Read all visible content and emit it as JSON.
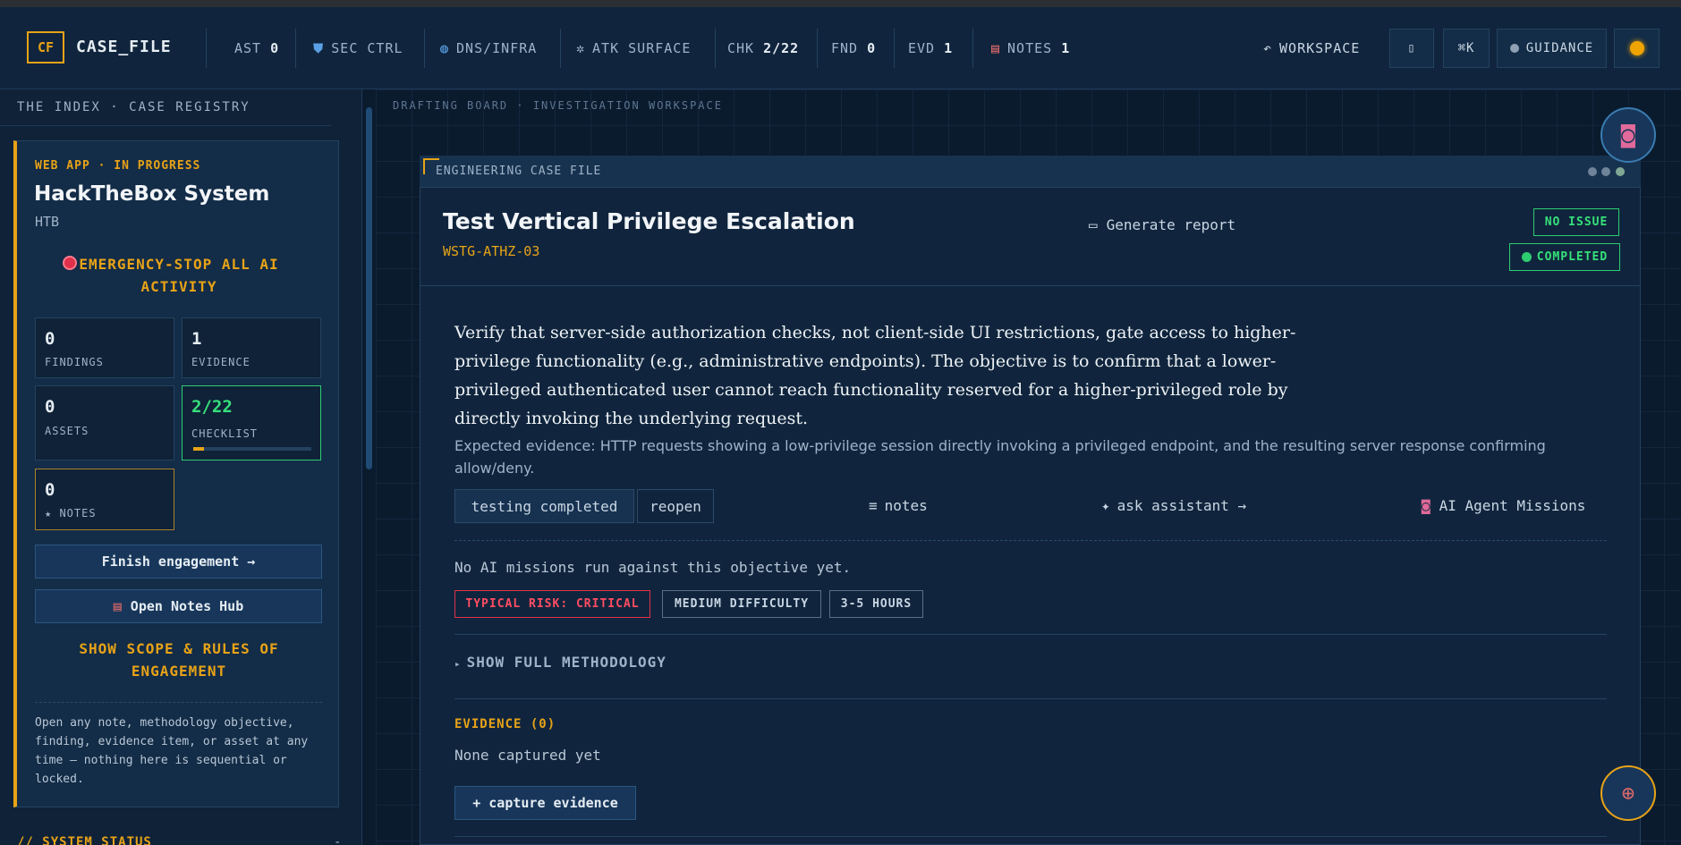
{
  "topbar": {
    "logo_mark": "CF",
    "logo_text": "CASE_FILE",
    "stats": [
      {
        "label": "AST",
        "value": "0"
      },
      {
        "label": "SEC CTRL",
        "icon": "shield-icon"
      },
      {
        "label": "DNS/INFRA",
        "icon": "globe-icon"
      },
      {
        "label": "ATK SURFACE",
        "icon": "radar-icon"
      },
      {
        "label": "CHK",
        "value": "2/22"
      },
      {
        "label": "FND",
        "value": "0"
      },
      {
        "label": "EVD",
        "value": "1"
      },
      {
        "label": "NOTES",
        "value": "1",
        "icon": "notebook-icon"
      }
    ],
    "workspace_label": "WORKSPACE",
    "cmdk_label": "⌘K",
    "guidance_label": "GUIDANCE"
  },
  "sidebar": {
    "heading": "THE INDEX · CASE REGISTRY",
    "case": {
      "tag": "WEB APP · IN PROGRESS",
      "title": "HackTheBox System",
      "subtitle": "HTB",
      "estop_label": "EMERGENCY-STOP ALL AI ACTIVITY",
      "metrics": {
        "findings": {
          "value": "0",
          "label": "FINDINGS"
        },
        "evidence": {
          "value": "1",
          "label": "EVIDENCE"
        },
        "assets": {
          "value": "0",
          "label": "ASSETS"
        },
        "checklist": {
          "value": "2/22",
          "label": "CHECKLIST",
          "progress_fraction": 0.09
        },
        "notes": {
          "value": "0",
          "label": "★ NOTES"
        }
      },
      "finish_button": "Finish engagement →",
      "notes_hub_button": "Open Notes Hub",
      "scope_link": "SHOW SCOPE & RULES OF ENGAGEMENT",
      "help_text": "Open any note, methodology objective, finding, evidence item, or asset at any time — nothing here is sequential or locked."
    },
    "system_status": "// SYSTEM STATUS",
    "system_status_toggle": "-"
  },
  "main": {
    "board_label": "DRAFTING BOARD · INVESTIGATION WORKSPACE",
    "panel": {
      "label": "ENGINEERING CASE FILE",
      "title": "Test Vertical Privilege Escalation",
      "code": "WSTG-ATHZ-03",
      "generate_report": "Generate report",
      "badge_issue": "NO ISSUE",
      "badge_status": "COMPLETED",
      "objective": "Verify that server-side authorization checks, not client-side UI restrictions, gate access to higher-privilege functionality (e.g., administrative endpoints). The objective is to confirm that a lower-privileged authenticated user cannot reach functionality reserved for a higher-privileged role by directly invoking the underlying request.",
      "expected": "Expected evidence: HTTP requests showing a low-privilege session directly invoking a privileged endpoint, and the resulting server response confirming allow/deny.",
      "chips": {
        "testing_completed": "testing completed",
        "reopen": "reopen"
      },
      "actions": {
        "notes": "notes",
        "ask_assistant": "ask assistant →",
        "ai_missions": "AI Agent Missions"
      },
      "no_missions": "No AI missions run against this objective yet.",
      "tags": {
        "risk": "TYPICAL RISK: CRITICAL",
        "difficulty": "MEDIUM DIFFICULTY",
        "time": "3-5 HOURS"
      },
      "methodology_toggle": "SHOW FULL METHODOLOGY",
      "evidence_title": "EVIDENCE (0)",
      "evidence_empty": "None captured yet",
      "capture_button": "+ capture evidence"
    }
  },
  "colors": {
    "accent": "#e8a317",
    "success": "#2ecc71",
    "danger": "#e0304a",
    "background": "#0b1b2e"
  }
}
